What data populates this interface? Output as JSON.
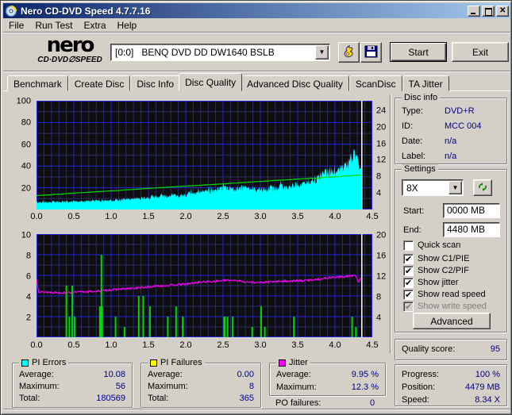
{
  "window": {
    "title": "Nero CD-DVD Speed 4.7.7.16"
  },
  "menu": {
    "items": [
      "File",
      "Run Test",
      "Extra",
      "Help"
    ]
  },
  "toolbar": {
    "logo_line1": "nero",
    "logo_line2": "CD·DVD∅SPEED",
    "drive_select": "[0:0]   BENQ DVD DD DW1640 BSLB",
    "start_label": "Start",
    "exit_label": "Exit"
  },
  "tabs": {
    "items": [
      "Benchmark",
      "Create Disc",
      "Disc Info",
      "Disc Quality",
      "Advanced Disc Quality",
      "ScanDisc",
      "TA Jitter"
    ],
    "active": "Disc Quality"
  },
  "disc_info": {
    "title": "Disc info",
    "rows": [
      {
        "label": "Type:",
        "value": "DVD+R"
      },
      {
        "label": "ID:",
        "value": "MCC 004"
      },
      {
        "label": "Date:",
        "value": "n/a"
      },
      {
        "label": "Label:",
        "value": "n/a"
      }
    ]
  },
  "settings": {
    "title": "Settings",
    "speed": "8X",
    "start_label": "Start:",
    "start_value": "0000 MB",
    "end_label": "End:",
    "end_value": "4480 MB",
    "checkboxes": [
      {
        "label": "Quick scan",
        "state": "unchecked"
      },
      {
        "label": "Show C1/PIE",
        "state": "checked"
      },
      {
        "label": "Show C2/PIF",
        "state": "checked"
      },
      {
        "label": "Show jitter",
        "state": "checked"
      },
      {
        "label": "Show read speed",
        "state": "checked"
      },
      {
        "label": "Show write speed",
        "state": "checked-disabled"
      }
    ],
    "advanced_label": "Advanced"
  },
  "quality": {
    "label": "Quality score:",
    "value": "95"
  },
  "progress": {
    "rows": [
      {
        "label": "Progress:",
        "value": "100 %"
      },
      {
        "label": "Position:",
        "value": "4479 MB"
      },
      {
        "label": "Speed:",
        "value": "8.34 X"
      }
    ]
  },
  "stats": {
    "pi_errors": {
      "title": "PI Errors",
      "color": "#00ffff",
      "rows": [
        {
          "label": "Average:",
          "value": "10.08"
        },
        {
          "label": "Maximum:",
          "value": "56"
        },
        {
          "label": "Total:",
          "value": "180569"
        }
      ]
    },
    "pi_failures": {
      "title": "PI Failures",
      "color": "#ffff00",
      "rows": [
        {
          "label": "Average:",
          "value": "0.00"
        },
        {
          "label": "Maximum:",
          "value": "8"
        },
        {
          "label": "Total:",
          "value": "365"
        }
      ]
    },
    "jitter": {
      "title": "Jitter",
      "color": "#ff00ff",
      "rows": [
        {
          "label": "Average:",
          "value": "9.95 %"
        },
        {
          "label": "Maximum:",
          "value": "12.3 %"
        }
      ],
      "extra": {
        "label": "PO failures:",
        "value": "0"
      }
    }
  },
  "chart_data": [
    {
      "type": "area",
      "title": "PI Errors (cyan area, left axis) and read speed (green line, right axis X)",
      "x_range": [
        0,
        4.5
      ],
      "x_ticks": [
        0.0,
        0.5,
        1.0,
        1.5,
        2.0,
        2.5,
        3.0,
        3.5,
        4.0,
        4.5
      ],
      "y_left": {
        "label": "PI Errors",
        "range": [
          0,
          100
        ],
        "ticks": [
          20,
          40,
          60,
          80,
          100
        ]
      },
      "y_right": {
        "label": "Read speed (X)",
        "range": [
          0,
          26.3
        ],
        "ticks": [
          4,
          8,
          12,
          16,
          20,
          24
        ]
      },
      "grid": {
        "x_major": 0.5,
        "x_minor": 0.1,
        "y_major": 20,
        "y_minor": 10
      },
      "colors": {
        "bg": "#0e0e10",
        "grid_major": "#2424d8",
        "grid_minor": "#2c2c6a",
        "cursor": "#ffffff"
      },
      "cursor_x": 4.36,
      "sample_step": 0.008,
      "series": [
        {
          "name": "PI Errors",
          "type": "area",
          "axis": "left",
          "color": "#00ffff",
          "seed": 42,
          "noise_rel": 0.16,
          "spike_p": 0.05,
          "spike": 1.18,
          "points": [
            [
              0,
              6.5
            ],
            [
              0.3,
              7
            ],
            [
              0.6,
              7.5
            ],
            [
              0.9,
              8.2
            ],
            [
              1.2,
              9.2
            ],
            [
              1.5,
              11
            ],
            [
              1.8,
              12.5
            ],
            [
              2.0,
              13.5
            ],
            [
              2.15,
              15.5
            ],
            [
              2.3,
              16.5
            ],
            [
              2.45,
              18.5
            ],
            [
              2.6,
              19.5
            ],
            [
              2.8,
              19.5
            ],
            [
              3.0,
              19
            ],
            [
              3.2,
              20
            ],
            [
              3.4,
              21.5
            ],
            [
              3.6,
              23.5
            ],
            [
              3.75,
              27
            ],
            [
              3.85,
              33
            ],
            [
              3.95,
              35
            ],
            [
              4.05,
              36
            ],
            [
              4.15,
              40
            ],
            [
              4.22,
              46
            ],
            [
              4.27,
              49
            ],
            [
              4.31,
              43
            ],
            [
              4.36,
              41
            ]
          ]
        },
        {
          "name": "Read speed",
          "type": "line",
          "axis": "right",
          "color": "#00d800",
          "seed": 7,
          "noise_abs": 0.05,
          "points": [
            [
              0,
              3.35
            ],
            [
              0.5,
              3.95
            ],
            [
              1.0,
              4.5
            ],
            [
              1.5,
              5.1
            ],
            [
              2.0,
              5.65
            ],
            [
              2.5,
              6.2
            ],
            [
              3.0,
              6.8
            ],
            [
              3.5,
              7.35
            ],
            [
              4.0,
              7.9
            ],
            [
              4.36,
              8.34
            ]
          ]
        }
      ]
    },
    {
      "type": "line+bars",
      "title": "PI Failures (green bars, left axis) and jitter % (magenta line, right axis)",
      "x_range": [
        0,
        4.5
      ],
      "x_ticks": [
        0.0,
        0.5,
        1.0,
        1.5,
        2.0,
        2.5,
        3.0,
        3.5,
        4.0,
        4.5
      ],
      "y_left": {
        "label": "PI Failures",
        "range": [
          0,
          10
        ],
        "ticks": [
          2,
          4,
          6,
          8,
          10
        ]
      },
      "y_right": {
        "label": "Jitter %",
        "range": [
          0,
          20
        ],
        "ticks": [
          4,
          8,
          12,
          16,
          20
        ]
      },
      "grid": {
        "x_major": 0.5,
        "x_minor": 0.1,
        "y_major": 2,
        "y_minor": 1
      },
      "colors": {
        "bg": "#0e0e10",
        "grid_major": "#2424d8",
        "grid_minor": "#2c2c6a",
        "cursor": "#ffffff"
      },
      "cursor_x": 4.36,
      "sample_step": 0.008,
      "series": [
        {
          "name": "Jitter",
          "type": "line",
          "axis": "right",
          "color": "#f000f0",
          "seed": 13,
          "noise_abs": 0.18,
          "points": [
            [
              0,
              11.2
            ],
            [
              0.03,
              8.8
            ],
            [
              0.2,
              8.7
            ],
            [
              0.4,
              8.6
            ],
            [
              0.6,
              8.8
            ],
            [
              0.8,
              8.9
            ],
            [
              1.0,
              9.2
            ],
            [
              1.2,
              9.4
            ],
            [
              1.4,
              9.6
            ],
            [
              1.6,
              9.9
            ],
            [
              1.8,
              10.1
            ],
            [
              2.0,
              10.3
            ],
            [
              2.2,
              10.7
            ],
            [
              2.35,
              10.8
            ],
            [
              2.5,
              11.0
            ],
            [
              2.65,
              11.1
            ],
            [
              2.8,
              10.7
            ],
            [
              3.0,
              10.6
            ],
            [
              3.2,
              10.8
            ],
            [
              3.4,
              10.9
            ],
            [
              3.6,
              11.0
            ],
            [
              3.8,
              11.3
            ],
            [
              3.95,
              11.6
            ],
            [
              4.1,
              11.7
            ],
            [
              4.2,
              11.9
            ],
            [
              4.28,
              11.9
            ],
            [
              4.31,
              10.8
            ],
            [
              4.36,
              11.5
            ]
          ]
        },
        {
          "name": "PI Failures",
          "type": "bars",
          "axis": "left",
          "color": "#00d800",
          "bars": [
            [
              0.4,
              5
            ],
            [
              0.44,
              2
            ],
            [
              0.48,
              5
            ],
            [
              0.51,
              2
            ],
            [
              0.865,
              3,
              5
            ],
            [
              0.87,
              8,
              2
            ],
            [
              1.06,
              2
            ],
            [
              1.18,
              1
            ],
            [
              1.37,
              4
            ],
            [
              1.43,
              4
            ],
            [
              1.52,
              3
            ],
            [
              1.76,
              2
            ],
            [
              1.87,
              3
            ],
            [
              1.96,
              2
            ],
            [
              2.52,
              2,
              3
            ],
            [
              2.56,
              2
            ],
            [
              2.63,
              2
            ],
            [
              2.89,
              1
            ],
            [
              3.01,
              3
            ],
            [
              3.06,
              1
            ],
            [
              3.45,
              2
            ],
            [
              4.23,
              2
            ],
            [
              4.28,
              1
            ]
          ]
        }
      ]
    }
  ]
}
